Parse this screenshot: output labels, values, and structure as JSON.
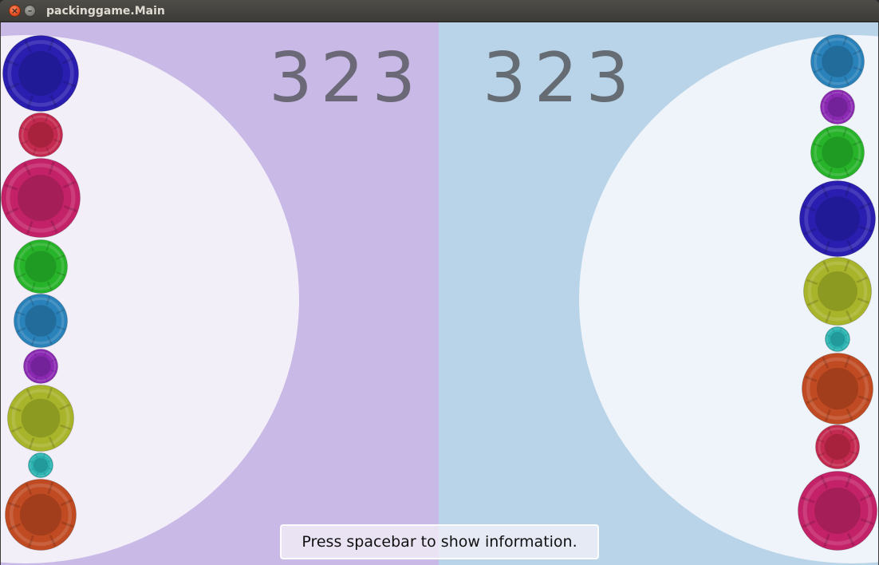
{
  "window": {
    "title": "packinggame.Main"
  },
  "scores": {
    "left": "323",
    "right": "323"
  },
  "info_bar": {
    "message": "Press spacebar to show information."
  },
  "colors": {
    "left_panel": "#c9b9e6",
    "right_panel": "#b9d4e8",
    "left_arena": "#f3eff9",
    "right_arena": "#eef4f9",
    "score_text": "#6b6877"
  },
  "ball_colors": {
    "navy": {
      "outer": "#2a1eb0",
      "inner": "#201a96"
    },
    "crimson": {
      "outer": "#c42a50",
      "inner": "#a8223e"
    },
    "magenta": {
      "outer": "#c42268",
      "inner": "#a61e58"
    },
    "green": {
      "outer": "#28b42a",
      "inner": "#1f9a22"
    },
    "steel": {
      "outer": "#2a82ba",
      "inner": "#226c9c"
    },
    "purple": {
      "outer": "#8c2ab4",
      "inner": "#74229a"
    },
    "olive": {
      "outer": "#a8b42a",
      "inner": "#8c9a22"
    },
    "teal": {
      "outer": "#2cb4b2",
      "inner": "#22999a"
    },
    "rust": {
      "outer": "#c04a22",
      "inner": "#a23e1c"
    }
  },
  "left_column": [
    {
      "color": "navy"
    },
    {
      "color": "crimson"
    },
    {
      "color": "magenta"
    },
    {
      "color": "green"
    },
    {
      "color": "steel"
    },
    {
      "color": "purple"
    },
    {
      "color": "olive"
    },
    {
      "color": "teal"
    },
    {
      "color": "rust"
    }
  ],
  "right_column": [
    {
      "color": "steel"
    },
    {
      "color": "purple"
    },
    {
      "color": "green"
    },
    {
      "color": "navy"
    },
    {
      "color": "olive"
    },
    {
      "color": "teal"
    },
    {
      "color": "rust"
    },
    {
      "color": "crimson"
    },
    {
      "color": "magenta"
    }
  ]
}
